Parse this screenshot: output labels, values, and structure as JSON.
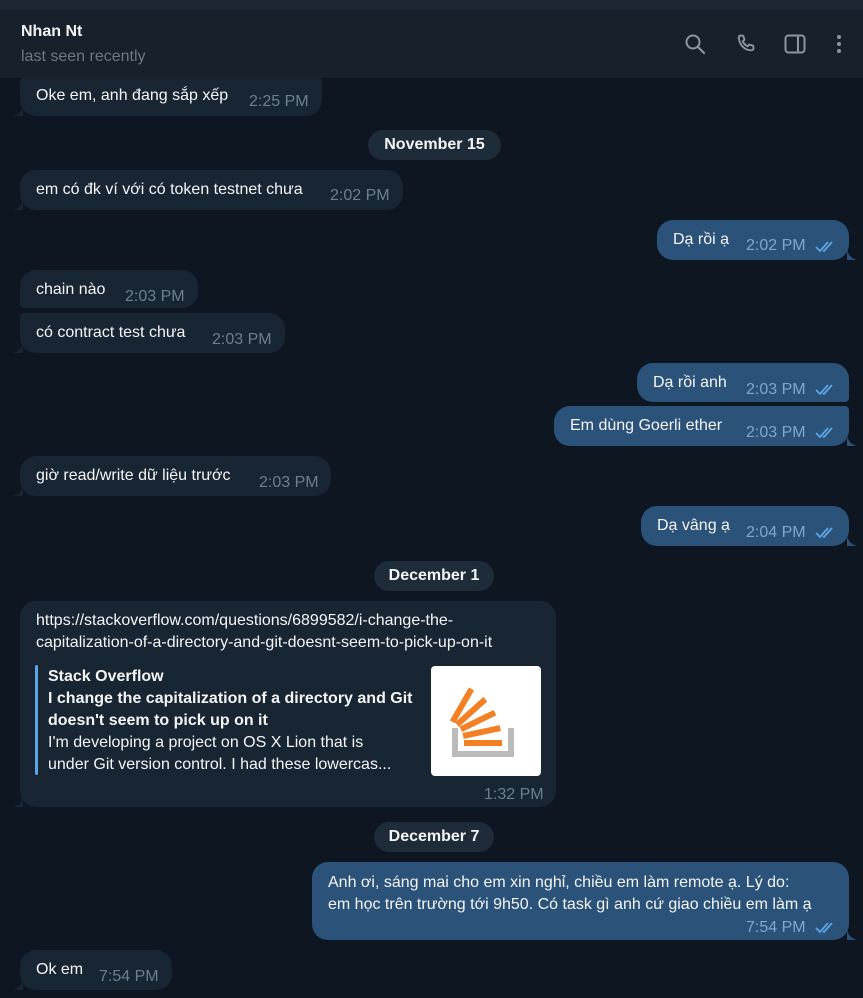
{
  "header": {
    "contact_name": "Nhan Nt",
    "status": "last seen recently",
    "icons": [
      "search-icon",
      "phone-icon",
      "sidebar-toggle-icon",
      "more-vertical-icon"
    ]
  },
  "colors": {
    "background": "#0e1621",
    "incoming_bubble": "#182533",
    "outgoing_bubble": "#2b5278",
    "link": "#71baf5",
    "read_ticks": "#5ea5e5"
  },
  "messages": [
    {
      "id": "m1",
      "dir": "in",
      "text": "Oke em, anh đang sắp xếp",
      "time": "2:25 PM"
    },
    {
      "id": "d1",
      "date": "November 15"
    },
    {
      "id": "m2",
      "dir": "in",
      "text": "em có đk ví với có token testnet chưa",
      "time": "2:02 PM"
    },
    {
      "id": "m3",
      "dir": "out",
      "text": "Dạ rồi ạ",
      "time": "2:02 PM",
      "read": true
    },
    {
      "id": "m4",
      "dir": "in",
      "text": "chain nào",
      "time": "2:03 PM"
    },
    {
      "id": "m5",
      "dir": "in",
      "text": "có contract test chưa",
      "time": "2:03 PM"
    },
    {
      "id": "m6",
      "dir": "out",
      "text": "Dạ rồi anh",
      "time": "2:03 PM",
      "read": true
    },
    {
      "id": "m7",
      "dir": "out",
      "text": "Em dùng Goerli ether",
      "time": "2:03 PM",
      "read": true
    },
    {
      "id": "m8",
      "dir": "in",
      "text": "giờ read/write dữ liệu trước",
      "time": "2:03 PM"
    },
    {
      "id": "m9",
      "dir": "out",
      "text": "Dạ vâng ạ",
      "time": "2:04 PM",
      "read": true
    },
    {
      "id": "d2",
      "date": "December 1"
    },
    {
      "id": "m10",
      "dir": "in",
      "link_lines": [
        "https://stackoverflow.com/questions/6899582/i-change-the-",
        "capitalization-of-a-directory-and-git-doesnt-seem-to-pick-up-on-it"
      ],
      "preview": {
        "site": "Stack Overflow",
        "title_lines": [
          "I change the capitalization of a directory and Git",
          "doesn't seem to pick up on it"
        ],
        "desc_lines": [
          "I'm developing a project on OS X Lion that is",
          "under Git version control. I had these lowercas..."
        ],
        "thumbnail_icon": "stackoverflow-logo-icon"
      },
      "time": "1:32 PM"
    },
    {
      "id": "d3",
      "date": "December 7"
    },
    {
      "id": "m11",
      "dir": "out",
      "lines": [
        "Anh ơi, sáng  mai cho em xin nghỉ, chiều em làm remote ạ. Lý do:",
        "em học trên trường tới 9h50. Có task gì anh cứ giao chiều em làm ạ"
      ],
      "time": "7:54 PM",
      "read": true
    },
    {
      "id": "m12",
      "dir": "in",
      "text": "Ok em",
      "time": "7:54 PM"
    }
  ]
}
